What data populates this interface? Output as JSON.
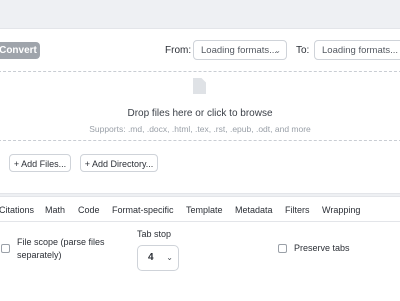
{
  "toolbar": {
    "convert_label": "Convert",
    "from_label": "From:",
    "from_value": "Loading formats...",
    "to_label": "To:",
    "to_value": "Loading formats..."
  },
  "dropzone": {
    "title": "Drop files here or click to browse",
    "supported": "Supports: .md, .docx, .html, .tex, .rst, .epub, .odt, and more"
  },
  "file_actions": {
    "edge_text": ")",
    "add_files_label": "+ Add Files...",
    "add_directory_label": "+ Add Directory..."
  },
  "tabs": [
    "Citations",
    "Math",
    "Code",
    "Format-specific",
    "Template",
    "Metadata",
    "Filters",
    "Wrapping"
  ],
  "options": {
    "file_scope_label": "File scope (parse files separately)",
    "tab_stop_label": "Tab stop",
    "tab_stop_value": "4",
    "preserve_tabs_label": "Preserve tabs"
  },
  "colors": {
    "convert_bg": "#9fa4ab",
    "border": "#cfd3d9",
    "page_bg": "#eef0f3"
  }
}
